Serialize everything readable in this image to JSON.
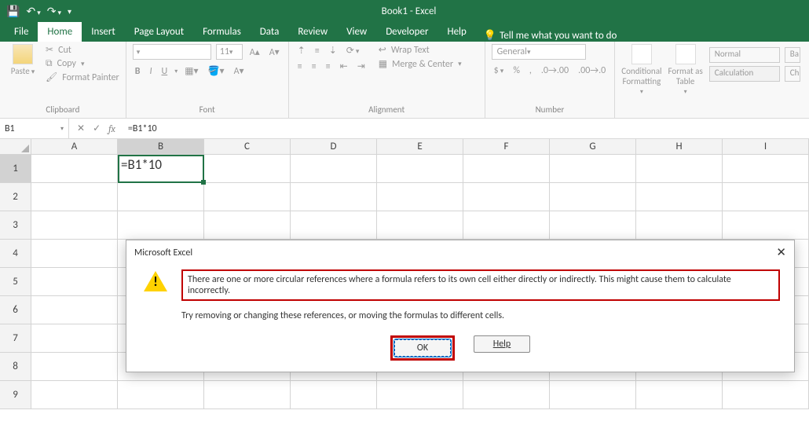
{
  "titlebar": {
    "title": "Book1  -  Excel"
  },
  "tabs": [
    "File",
    "Home",
    "Insert",
    "Page Layout",
    "Formulas",
    "Data",
    "Review",
    "View",
    "Developer",
    "Help"
  ],
  "active_tab": "Home",
  "tell_me": "Tell me what you want to do",
  "ribbon": {
    "clipboard": {
      "paste": "Paste",
      "cut": "Cut",
      "copy": "Copy",
      "painter": "Format Painter",
      "label": "Clipboard"
    },
    "font": {
      "name": "",
      "size": "11",
      "label": "Font"
    },
    "alignment": {
      "wrap": "Wrap Text",
      "merge": "Merge & Center",
      "label": "Alignment"
    },
    "number": {
      "format": "General",
      "label": "Number"
    },
    "styles": {
      "cond": "Conditional\nFormatting",
      "table": "Format as\nTable",
      "normal": "Normal",
      "bad": "Ba",
      "calc": "Calculation",
      "ch": "Ch"
    }
  },
  "namebox": "B1",
  "formula": "=B1*10",
  "columns": [
    "A",
    "B",
    "C",
    "D",
    "E",
    "F",
    "G",
    "H",
    "I"
  ],
  "rows": [
    "1",
    "2",
    "3",
    "4",
    "5",
    "6",
    "7",
    "8",
    "9"
  ],
  "active_cell_value": "=B1*10",
  "dialog": {
    "title": "Microsoft Excel",
    "msg1": "There are one or more circular references where a formula refers to its own cell either directly or indirectly. This might cause them to calculate incorrectly.",
    "msg2": "Try removing or changing these references, or moving the formulas to different cells.",
    "ok": "OK",
    "help": "Help"
  }
}
